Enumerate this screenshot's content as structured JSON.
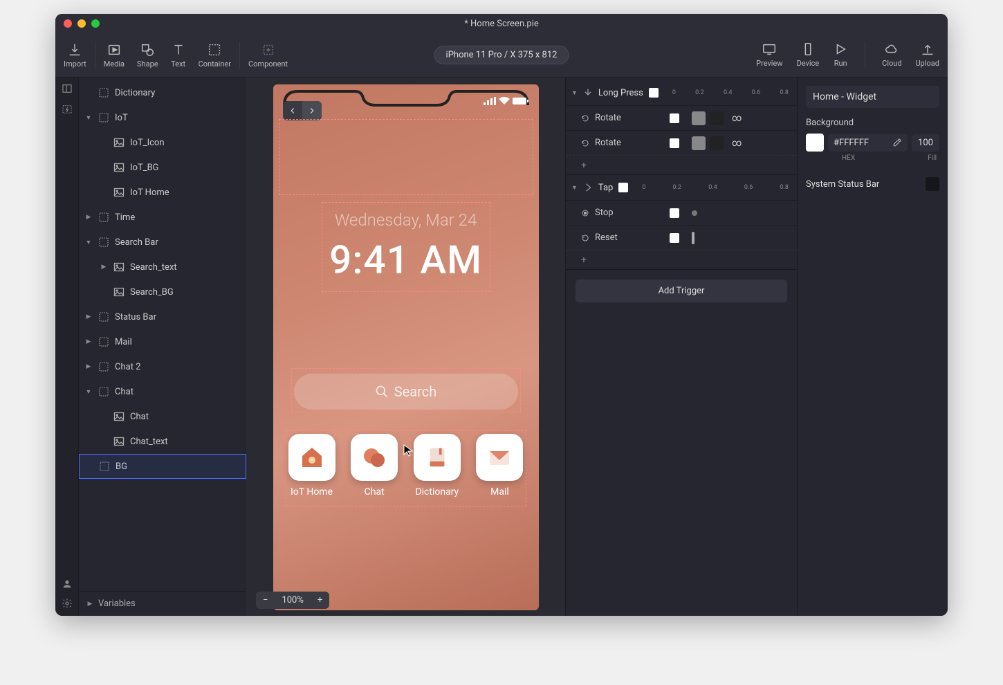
{
  "window": {
    "title": "* Home Screen.pie"
  },
  "toolbar": {
    "import": "Import",
    "media": "Media",
    "shape": "Shape",
    "text": "Text",
    "container": "Container",
    "component": "Component",
    "device_badge": "iPhone 11 Pro / X  375 x 812",
    "preview": "Preview",
    "device": "Device",
    "run": "Run",
    "cloud": "Cloud",
    "upload": "Upload"
  },
  "layers": {
    "items": [
      {
        "label": "Dictionary",
        "indent": 1,
        "expand": ""
      },
      {
        "label": "IoT",
        "indent": 1,
        "expand": "open"
      },
      {
        "label": "IoT_Icon",
        "indent": 2
      },
      {
        "label": "IoT_BG",
        "indent": 2
      },
      {
        "label": "IoT Home",
        "indent": 2
      },
      {
        "label": "Time",
        "indent": 1,
        "expand": "closed"
      },
      {
        "label": "Search Bar",
        "indent": 1,
        "expand": "open"
      },
      {
        "label": "Search_text",
        "indent": 2,
        "expand": "closed"
      },
      {
        "label": "Search_BG",
        "indent": 2
      },
      {
        "label": "Status Bar",
        "indent": 1,
        "expand": "closed"
      },
      {
        "label": "Mail",
        "indent": 1,
        "expand": "closed"
      },
      {
        "label": "Chat 2",
        "indent": 1,
        "expand": "closed"
      },
      {
        "label": "Chat",
        "indent": 1,
        "expand": "open"
      },
      {
        "label": "Chat",
        "indent": 2
      },
      {
        "label": "Chat_text",
        "indent": 2
      },
      {
        "label": "BG",
        "indent": 1,
        "selected": true
      }
    ],
    "footer": "Variables"
  },
  "canvas": {
    "date": "Wednesday, Mar 24",
    "time": "9:41 AM",
    "search": "Search",
    "apps": [
      "IoT Home",
      "Chat",
      "Dictionary",
      "Mail"
    ],
    "zoom": "100%"
  },
  "triggers": {
    "ruler": [
      "0",
      "0.2",
      "0.4",
      "0.6",
      "0.8"
    ],
    "blocks": [
      {
        "title": "Long Press",
        "actions": [
          {
            "label": "Rotate",
            "swatches": [
              "#888",
              "#222"
            ],
            "inf": true
          },
          {
            "label": "Rotate",
            "swatches": [
              "#888",
              "#222"
            ],
            "inf": true
          }
        ]
      },
      {
        "title": "Tap",
        "actions": [
          {
            "label": "Stop",
            "marker": "dot"
          },
          {
            "label": "Reset",
            "marker": "handle"
          }
        ]
      }
    ],
    "add": "Add Trigger"
  },
  "inspector": {
    "title": "Home - Widget",
    "bg_label": "Background",
    "bg_hex": "#FFFFFF",
    "bg_opacity": "100",
    "hex_label": "HEX",
    "fill_label": "Fill",
    "ssb": "System Status Bar"
  }
}
